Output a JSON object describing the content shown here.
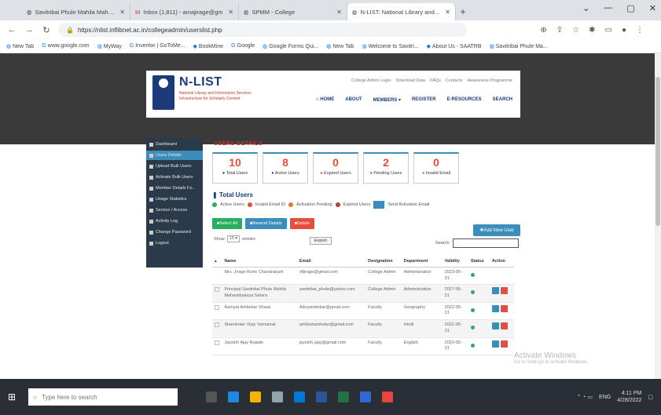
{
  "browser": {
    "tabs": [
      {
        "title": "Savitribai Phule Mahila Mahavid",
        "active": false
      },
      {
        "title": "Inbox (1,811) - amajirage@gm",
        "active": false
      },
      {
        "title": "SPMM - College",
        "active": false
      },
      {
        "title": "N-LIST: National Library and Inf",
        "active": true
      }
    ],
    "url": "https://nlist.inflibnet.ac.in/collegeadmin/userslist.php",
    "bookmarks": [
      "New Tab",
      "www.google.com",
      "MyWay",
      "Inventor | GoToMe...",
      "BookMine",
      "Google",
      "Google Forms Qui...",
      "New Tab",
      "Welcome to Savitri...",
      "About Us - SAATRB",
      "Savitribai Phule Ma..."
    ]
  },
  "site": {
    "brand": "N-LIST",
    "subtitle": "National Library and Information Services Infrastructure for Scholarly Content",
    "top_links": [
      "College Admin Login",
      "Download Data",
      "FAQs",
      "Contacts",
      "Awareness Programme"
    ],
    "nav": [
      "HOME",
      "ABOUT",
      "MEMBERS",
      "REGISTER",
      "E-RESOURCES",
      "SEARCH"
    ]
  },
  "sidebar": {
    "items": [
      {
        "label": "Dashboard",
        "active": false
      },
      {
        "label": "Users Details",
        "active": true
      },
      {
        "label": "Upload Bulk Users",
        "active": false
      },
      {
        "label": "Activate Bulk Users",
        "active": false
      },
      {
        "label": "Member Details Fo..",
        "active": false
      },
      {
        "label": "Usage Statistics",
        "active": false
      },
      {
        "label": "Service / Access",
        "active": false
      },
      {
        "label": "Activity Log",
        "active": false
      },
      {
        "label": "Change Password",
        "active": false
      },
      {
        "label": "Logout",
        "active": false
      }
    ]
  },
  "content": {
    "section_title": "USERS DETAILS",
    "stats": [
      {
        "value": "10",
        "label": "Total Users"
      },
      {
        "value": "8",
        "label": "Active Users"
      },
      {
        "value": "0",
        "label": "Expired Users"
      },
      {
        "value": "2",
        "label": "Pending Users"
      },
      {
        "value": "0",
        "label": "Invalid Email"
      }
    ],
    "total_users_label": "Total Users",
    "legend": {
      "active": "Active Users",
      "invalid": "Invalid Email ID",
      "pending": "Activation Pending",
      "expired": "Expired Users",
      "resend": "Send Activation Email"
    },
    "actions": {
      "select_all": "Select All",
      "resend": "Resend Details",
      "delete": "Delete",
      "add_new": "Add New User"
    },
    "length": {
      "show": "Show",
      "value": "10",
      "entries": "entries"
    },
    "export_label": "Export",
    "search_label": "Search:",
    "columns": [
      "Name",
      "Email",
      "Designation",
      "Department",
      "Validity",
      "Status",
      "Action"
    ],
    "rows": [
      {
        "name": "Mrs. Jirage Ruhe Chandrakant",
        "email": "rtfjirage@gmail.com",
        "designation": "College Admin",
        "department": "Administration",
        "validity": "2023-05-31"
      },
      {
        "name": "Principal Savitribai Phule Mahila Mahavidyalaya Satara",
        "email": "savitribai_phule@yahoo.com",
        "designation": "College Admin",
        "department": "Administration",
        "validity": "2027-05-31"
      },
      {
        "name": "Aamyat Ambekar Shasa",
        "email": "Alinyambekar@gmail.com",
        "designation": "Faculty",
        "department": "Geography",
        "validity": "2022-05-31"
      },
      {
        "name": "Shamkotar Vijay Vamanrat",
        "email": "amilsshamkotar@gmail.com",
        "designation": "Faculty",
        "department": "Hindi",
        "validity": "2022-05-31"
      },
      {
        "name": "Jaysinh Ajay Rajade",
        "email": "jaysinh.ajay@gmail.com",
        "designation": "Faculty",
        "department": "English",
        "validity": "2022-05-31"
      }
    ]
  },
  "watermark": {
    "title": "Activate Windows",
    "sub": "Go to Settings to activate Windows."
  },
  "taskbar": {
    "search_placeholder": "Type here to search",
    "time": "4:11 PM",
    "date": "4/28/2022",
    "lang": "ENG"
  }
}
